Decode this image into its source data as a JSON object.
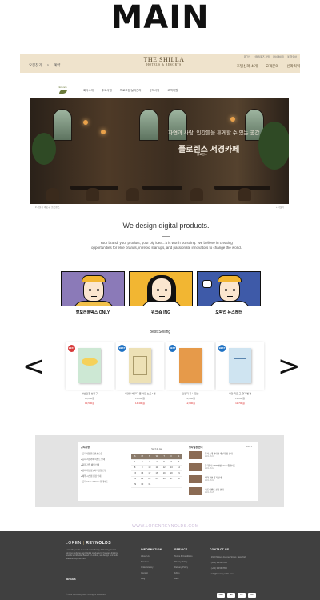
{
  "main_title": "MAIN",
  "shilla_header": {
    "left_items": [
      "요봉찾기",
      "예약"
    ],
    "logo_line1": "THE SHILLA",
    "logo_line2": "HOTELS & RESORTS",
    "top_right": [
      "로그인",
      "신라리워즈 가입",
      "마이페이지",
      "▣ 한국어"
    ],
    "nav": [
      "호텔신라 소개",
      "고객문의",
      "신라리워"
    ]
  },
  "cafe_site": {
    "logo_text": "Florence",
    "nav": [
      "회사소개",
      "주요사업",
      "프로그램/실적관리",
      "공지사항",
      "고객지원"
    ],
    "photo_subtitle": "자연과 사람, 인간들을 휴게할 수 있는 공간",
    "photo_title": "플로렌스 서경카페",
    "photo_caption": "플로렌스",
    "under_left": "# 서울시 마포구, 플로렌스",
    "under_right": "+ 더보기"
  },
  "digital": {
    "title": "We design digital products.",
    "body": "Your brand, your product, your big idea...it is worth pursuing. We believe in creating opportunities for elite brands, intrepid startups, and passionate innovators to change the world."
  },
  "characters": [
    {
      "label": "할모러블박스 ONLY",
      "bg": "#8b7ab8"
    },
    {
      "label": "워크숍 ING",
      "bg": "#f2b632"
    },
    {
      "label": "오픽업 뉴스레터",
      "bg": "#3e5aa8"
    }
  ],
  "best_selling": {
    "title": "Best Selling",
    "books": [
      {
        "badge": "BEST",
        "badge_color": "#d83a3a",
        "cover": "#cde8d4",
        "name": "하남인천 성북구",
        "price": "15,000원",
        "sale": "13,500원"
      },
      {
        "badge": "BEST",
        "badge_color": "#1f72c4",
        "cover": "#ede1b6",
        "name": "사랑을 바꾸다 옆 사람 노트 1편",
        "price": "16,000원",
        "sale": "14,400원"
      },
      {
        "badge": "BEST",
        "badge_color": "#1f72c4",
        "cover": "#e69a4a",
        "name": "오렌지 지 나침반",
        "price": "14,000원",
        "sale": "12,600원"
      },
      {
        "badge": "BEST",
        "badge_color": "#1f72c4",
        "cover": "#cfe4f1",
        "name": "사랑 지금 그 향기 발견",
        "price": "13,000원",
        "sale": "11,700원"
      }
    ]
  },
  "dashboard": {
    "left_title": "공지사항",
    "left_items": [
      "공지사항 플로렌스 오픈",
      "공지 서경카페 이벤트 안내",
      "회원 가입 혜택 안내",
      "공지 개인정보처리방침 변경",
      "예약 시스템 점검 안내",
      "공지 Ideas & Notes 업데이트"
    ],
    "calendar_title": "2021.08",
    "calendar_head": [
      "S",
      "M",
      "T",
      "W",
      "T",
      "F",
      "S"
    ],
    "calendar_rows": [
      [
        "1",
        "2",
        "3",
        "4",
        "5",
        "6",
        "7"
      ],
      [
        "8",
        "9",
        "10",
        "11",
        "12",
        "13",
        "14"
      ],
      [
        "15",
        "16",
        "17",
        "18",
        "19",
        "20",
        "21"
      ],
      [
        "22",
        "23",
        "24",
        "25",
        "26",
        "27",
        "28"
      ],
      [
        "29",
        "30",
        "31",
        "",
        "",
        "",
        ""
      ]
    ],
    "right_title": "행사일정 안내",
    "right_more": "more +",
    "right_items": [
      {
        "text": "행사 소개 안내와 세부 일정 안내",
        "date": "2021-08-01"
      },
      {
        "text": "한국행사 3000여명 Ideas 업데이트",
        "date": "2021-08-12"
      },
      {
        "text": "예약 관련 공지 안내",
        "date": "2021-08-18"
      },
      {
        "text": "여름 이벤트 신청 안내",
        "date": "2021-08-25"
      }
    ]
  },
  "watermark": "WWW.LORENREYNOLDS.COM",
  "footer": {
    "brand_a": "LOREN",
    "brand_b": "REYNOLDS",
    "desc": "Loren Reynolds is a web consultancy delivering award-winning websites and digital products for forward-thinking brands worldwide. Based in London, we design and build beautiful experiences.",
    "details": "DETAILS",
    "copyright": "© 2019 Loren Reynolds. All Rights Reserved.",
    "information": {
      "title": "INFORMATION",
      "items": [
        "About Us",
        "Services",
        "Order History",
        "Contact",
        "Blog"
      ]
    },
    "service": {
      "title": "SERVICE",
      "items": [
        "Terms & Conditions",
        "Privacy Policy",
        "Delivery Policy",
        "FAQs",
        "Help"
      ]
    },
    "contact": {
      "title": "CONTACT US",
      "items": [
        "1940 Nelson Avenue Street, New York",
        "(+12) 3-456-7890",
        "(+12) 3-456-7890",
        "info@lorenreynolds.com"
      ]
    },
    "payments": [
      "VISA",
      "MC",
      "PP",
      "AX",
      "DC"
    ]
  }
}
